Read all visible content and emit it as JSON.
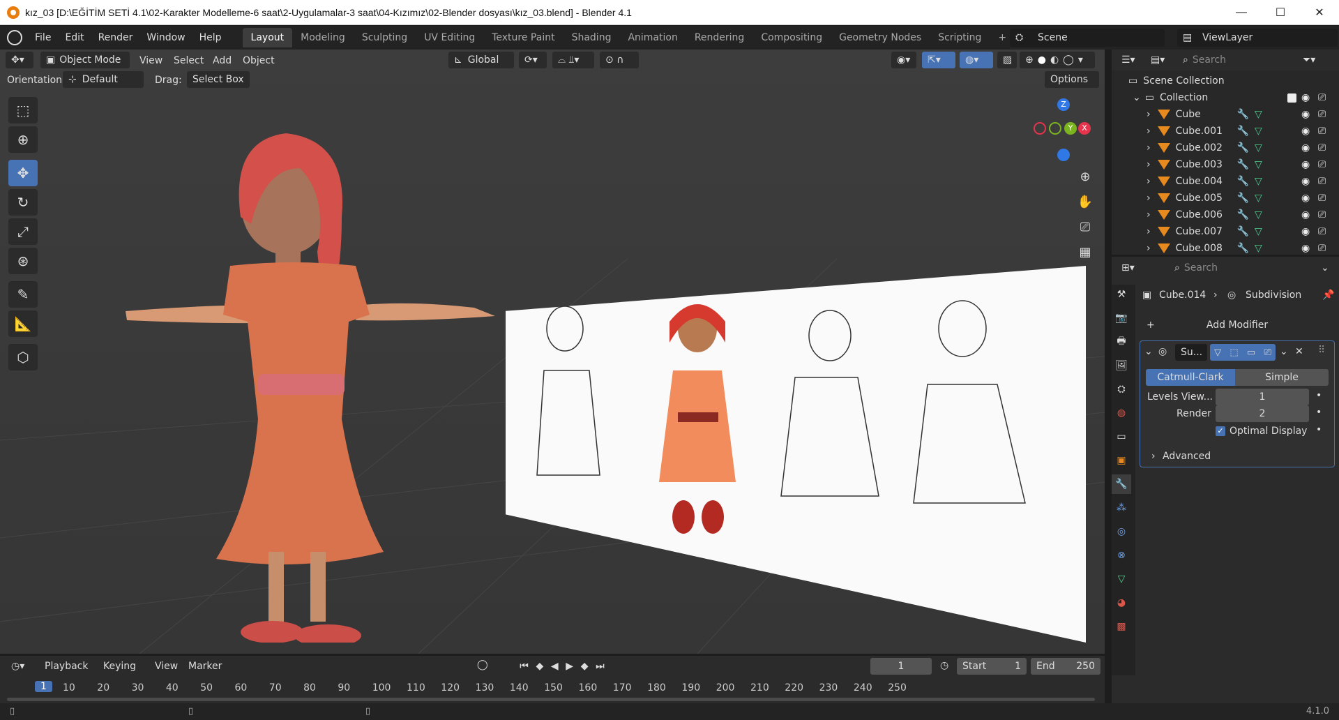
{
  "window": {
    "title": "kız_03 [D:\\EĞİTİM SETİ 4.1\\02-Karakter Modelleme-6 saat\\2-Uygulamalar-3  saat\\04-Kızımız\\02-Blender dosyası\\kız_03.blend] - Blender 4.1",
    "minimize": "—",
    "maximize": "☐",
    "close": "✕"
  },
  "menu": [
    "File",
    "Edit",
    "Render",
    "Window",
    "Help"
  ],
  "workspaces": [
    "Layout",
    "Modeling",
    "Sculpting",
    "UV Editing",
    "Texture Paint",
    "Shading",
    "Animation",
    "Rendering",
    "Compositing",
    "Geometry Nodes",
    "Scripting"
  ],
  "active_workspace": "Layout",
  "add_workspace": "+",
  "scene": {
    "label": "Scene",
    "viewlayer": "ViewLayer"
  },
  "viewport": {
    "mode": "Object Mode",
    "menus": [
      "View",
      "Select",
      "Add",
      "Object"
    ],
    "transform": "Global",
    "orientation_label": "Orientation:",
    "orientation_value": "Default",
    "drag_label": "Drag:",
    "drag_value": "Select Box",
    "options": "Options",
    "gizmo": {
      "z": "Z",
      "x": "X",
      "y": "Y"
    }
  },
  "outliner": {
    "search_placeholder": "Search",
    "root": "Scene Collection",
    "collection": "Collection",
    "objects": [
      "Cube",
      "Cube.001",
      "Cube.002",
      "Cube.003",
      "Cube.004",
      "Cube.005",
      "Cube.006",
      "Cube.007",
      "Cube.008"
    ]
  },
  "properties": {
    "search_placeholder": "Search",
    "object": "Cube.014",
    "modifier_path": "Subdivision",
    "add_modifier": "Add Modifier",
    "modifier_short": "Su...",
    "algo_catmull": "Catmull-Clark",
    "algo_simple": "Simple",
    "levels_label": "Levels View...",
    "levels_value": "1",
    "render_label": "Render",
    "render_value": "2",
    "optimal_label": "Optimal Display",
    "advanced": "Advanced"
  },
  "timeline": {
    "menus": [
      "Playback",
      "Keying",
      "View",
      "Marker"
    ],
    "current_frame": "1",
    "start_label": "Start",
    "start_value": "1",
    "end_label": "End",
    "end_value": "250",
    "ruler": [
      "1",
      "10",
      "20",
      "30",
      "40",
      "50",
      "60",
      "70",
      "80",
      "90",
      "100",
      "110",
      "120",
      "130",
      "140",
      "150",
      "160",
      "170",
      "180",
      "190",
      "200",
      "210",
      "220",
      "230",
      "240",
      "250"
    ]
  },
  "status": {
    "version": "4.1.0"
  }
}
